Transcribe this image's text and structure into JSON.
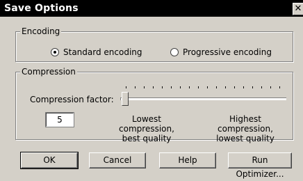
{
  "window": {
    "title": "Save Options",
    "close_glyph": "✕"
  },
  "encoding": {
    "legend": "Encoding",
    "options": [
      {
        "label": "Standard encoding",
        "checked": true
      },
      {
        "label": "Progressive encoding",
        "checked": false
      }
    ]
  },
  "compression": {
    "legend": "Compression",
    "factor_label": "Compression factor:",
    "factor_value": "5",
    "slider_position": 0,
    "low_caption_line1": "Lowest compression,",
    "low_caption_line2": "best quality",
    "high_caption_line1": "Highest compression,",
    "high_caption_line2": "lowest quality"
  },
  "buttons": {
    "ok": "OK",
    "cancel": "Cancel",
    "help": "Help",
    "run_optimizer": "Run Optimizer..."
  }
}
